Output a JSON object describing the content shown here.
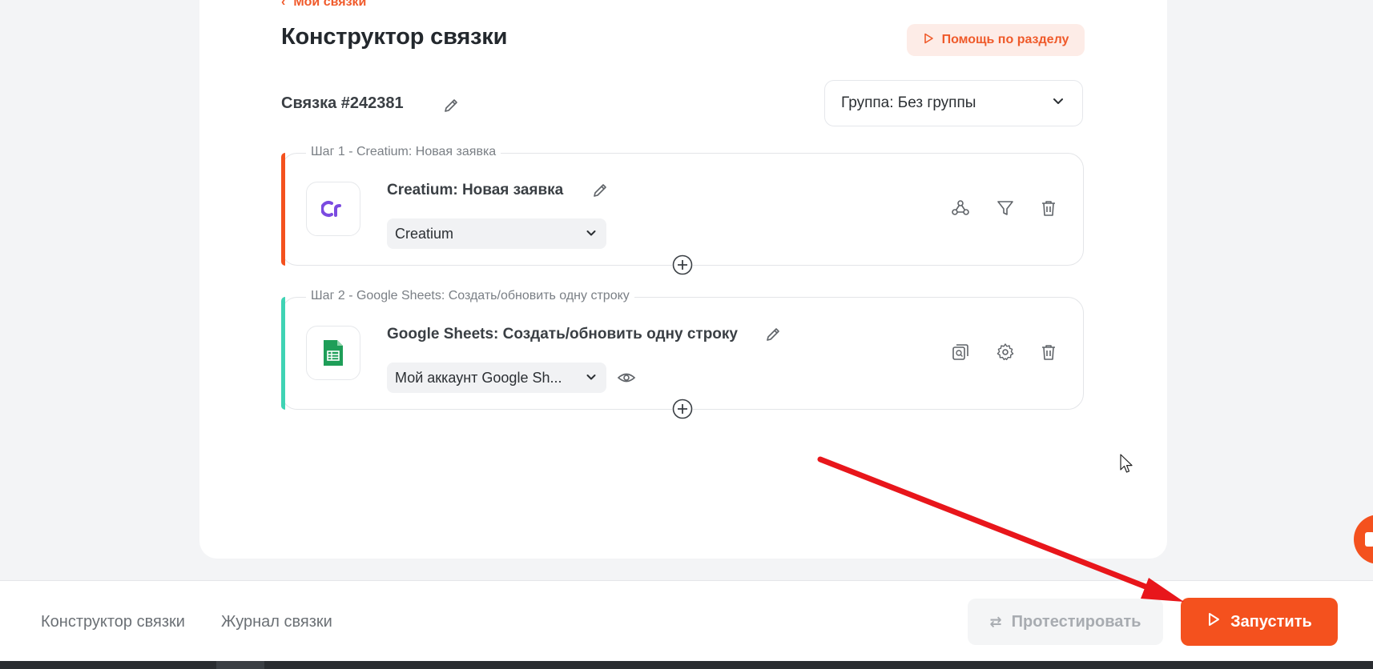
{
  "breadcrumb": {
    "label": "Мои связки"
  },
  "page": {
    "title": "Конструктор связки"
  },
  "help": {
    "label": "Помощь по разделу"
  },
  "link": {
    "name": "Связка #242381"
  },
  "group": {
    "label": "Группа: Без группы"
  },
  "steps": [
    {
      "legend": "Шаг 1 - Creatium: Новая заявка",
      "title": "Creatium: Новая заявка",
      "account": "Creatium",
      "accent_color": "#f4511e",
      "logo_icon": "creatium-logo-icon",
      "tools": [
        "webhook-icon",
        "filter-icon",
        "trash-icon"
      ]
    },
    {
      "legend": "Шаг 2 - Google Sheets: Создать/обновить одну строку",
      "title": "Google Sheets: Создать/обновить одну строку",
      "account": "Мой аккаунт Google Sh...",
      "accent_color": "#3fd3b4",
      "logo_icon": "google-sheets-icon",
      "tools": [
        "preview-copy-icon",
        "gear-icon",
        "trash-icon"
      ]
    }
  ],
  "bottom_nav": {
    "builder": "Конструктор связки",
    "journal": "Журнал связки",
    "test_label": "Протестировать",
    "run_label": "Запустить"
  },
  "colors": {
    "accent": "#f4511e",
    "help_bg": "#fdece7",
    "annotation_arrow": "#e8161b"
  }
}
